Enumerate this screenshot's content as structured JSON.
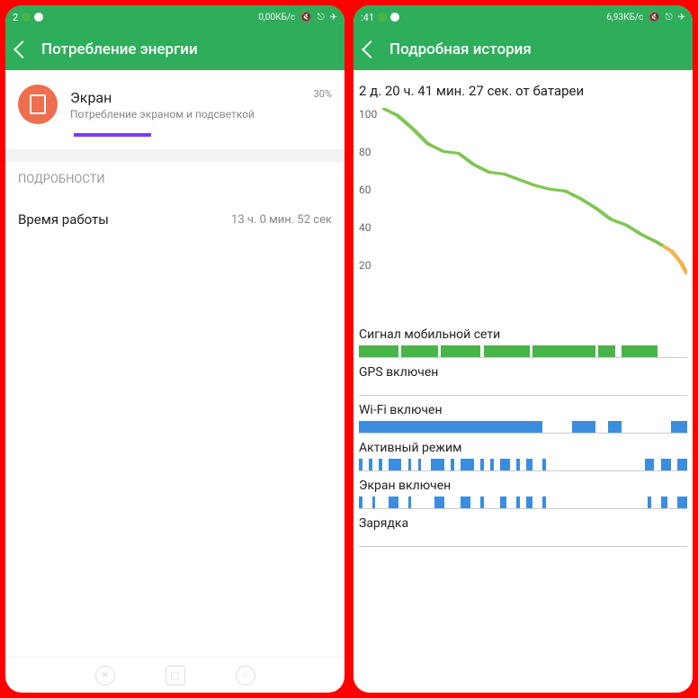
{
  "left": {
    "statusbar": {
      "time_suffix": "2",
      "speed": "0,00КБ/с"
    },
    "header": {
      "title": "Потребление энергии"
    },
    "app": {
      "name": "Экран",
      "subtitle": "Потребление экраном и подсветкой",
      "percent": "30%",
      "progress_pct": 30
    },
    "details": {
      "section_label": "ПОДРОБНОСТИ",
      "rows": [
        {
          "label": "Время работы",
          "value": "13 ч. 0 мин. 52 сек"
        }
      ]
    }
  },
  "right": {
    "statusbar": {
      "time_suffix": ":41",
      "speed": "6,93КБ/с"
    },
    "header": {
      "title": "Подробная история"
    },
    "battery_duration": "2 д. 20 ч. 41 мин. 27 сек. от батареи",
    "chart_data": {
      "type": "line",
      "ylabel": "",
      "ylim": [
        0,
        100
      ],
      "y_ticks": [
        "100",
        "80",
        "60",
        "40",
        "20"
      ],
      "x": [
        0,
        5,
        10,
        15,
        20,
        25,
        30,
        35,
        40,
        45,
        50,
        55,
        60,
        65,
        70,
        75,
        80,
        85,
        90,
        92,
        95,
        98,
        100
      ],
      "values": [
        100,
        96,
        89,
        81,
        77,
        76,
        70,
        66,
        65,
        62,
        59,
        57,
        56,
        52,
        47,
        41,
        38,
        33,
        29,
        27,
        24,
        18,
        12
      ],
      "end_segment_start_index": 19
    },
    "timelines": [
      {
        "label": "Сигнал мобильной сети",
        "segments": [
          {
            "start": 0,
            "end": 12,
            "color": "green"
          },
          {
            "start": 13,
            "end": 24,
            "color": "green"
          },
          {
            "start": 25,
            "end": 37,
            "color": "green"
          },
          {
            "start": 38,
            "end": 52,
            "color": "green"
          },
          {
            "start": 53,
            "end": 72,
            "color": "green"
          },
          {
            "start": 73,
            "end": 78,
            "color": "green"
          },
          {
            "start": 80,
            "end": 91,
            "color": "green"
          }
        ]
      },
      {
        "label": "GPS включен",
        "segments": []
      },
      {
        "label": "Wi-Fi включен",
        "segments": [
          {
            "start": 0,
            "end": 56,
            "color": "blue"
          },
          {
            "start": 65,
            "end": 72,
            "color": "blue"
          },
          {
            "start": 76,
            "end": 80,
            "color": "blue"
          },
          {
            "start": 95,
            "end": 100,
            "color": "blue"
          }
        ]
      },
      {
        "label": "Активный режим",
        "segments": [
          {
            "start": 0,
            "end": 1,
            "color": "blue"
          },
          {
            "start": 3,
            "end": 4,
            "color": "blue"
          },
          {
            "start": 6,
            "end": 7,
            "color": "blue"
          },
          {
            "start": 9,
            "end": 13,
            "color": "blue"
          },
          {
            "start": 15,
            "end": 16,
            "color": "blue"
          },
          {
            "start": 18,
            "end": 19,
            "color": "blue"
          },
          {
            "start": 22,
            "end": 26,
            "color": "blue"
          },
          {
            "start": 28,
            "end": 29,
            "color": "blue"
          },
          {
            "start": 31,
            "end": 35,
            "color": "blue"
          },
          {
            "start": 37,
            "end": 38,
            "color": "blue"
          },
          {
            "start": 40,
            "end": 41,
            "color": "blue"
          },
          {
            "start": 43,
            "end": 46,
            "color": "blue"
          },
          {
            "start": 48,
            "end": 49,
            "color": "blue"
          },
          {
            "start": 51,
            "end": 53,
            "color": "blue"
          },
          {
            "start": 56,
            "end": 57,
            "color": "blue"
          },
          {
            "start": 87,
            "end": 90,
            "color": "blue"
          },
          {
            "start": 92,
            "end": 95,
            "color": "blue"
          },
          {
            "start": 97,
            "end": 100,
            "color": "blue"
          }
        ]
      },
      {
        "label": "Экран включен",
        "segments": [
          {
            "start": 0,
            "end": 1,
            "color": "blue"
          },
          {
            "start": 4,
            "end": 5,
            "color": "blue"
          },
          {
            "start": 9,
            "end": 12,
            "color": "blue"
          },
          {
            "start": 15,
            "end": 16,
            "color": "blue"
          },
          {
            "start": 23,
            "end": 26,
            "color": "blue"
          },
          {
            "start": 31,
            "end": 34,
            "color": "blue"
          },
          {
            "start": 37,
            "end": 38,
            "color": "blue"
          },
          {
            "start": 43,
            "end": 45,
            "color": "blue"
          },
          {
            "start": 48,
            "end": 49,
            "color": "blue"
          },
          {
            "start": 51,
            "end": 53,
            "color": "blue"
          },
          {
            "start": 56,
            "end": 57,
            "color": "blue"
          },
          {
            "start": 88,
            "end": 89,
            "color": "blue"
          },
          {
            "start": 92,
            "end": 94,
            "color": "blue"
          },
          {
            "start": 97,
            "end": 100,
            "color": "blue"
          }
        ]
      },
      {
        "label": "Зарядка",
        "segments": []
      }
    ]
  }
}
